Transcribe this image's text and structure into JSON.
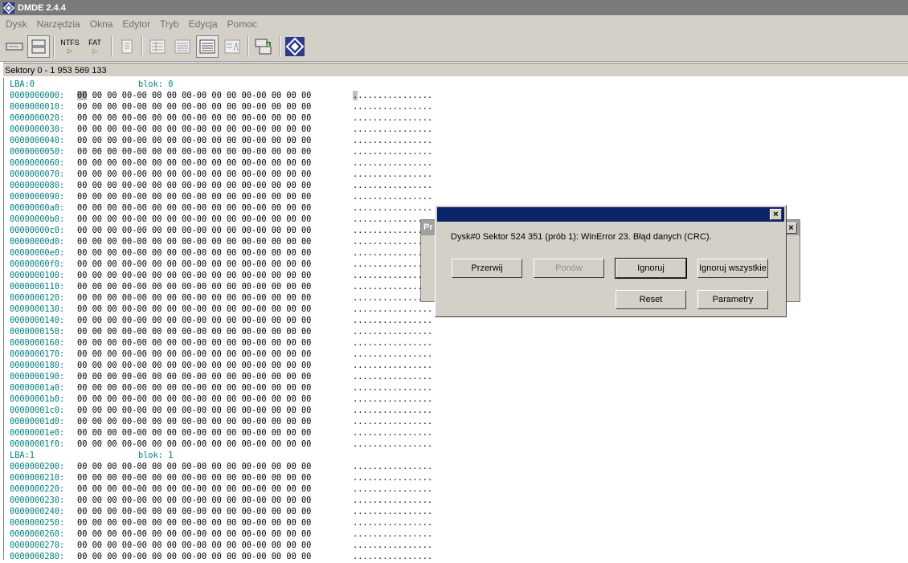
{
  "window": {
    "title": "DMDE 2.4.4"
  },
  "menu": [
    "Dysk",
    "Narzędzia",
    "Okna",
    "Edytor",
    "Tryb",
    "Edycja",
    "Pomoc"
  ],
  "toolbar": {
    "ntfs_label": "NTFS",
    "fat_label": "FAT"
  },
  "status": {
    "sectors": "Sektory 0 - 1 953 569 133"
  },
  "hex": {
    "sections": [
      {
        "lba": "LBA:0",
        "blok": "blok: 0",
        "addresses": [
          "0000000000:",
          "0000000010:",
          "0000000020:",
          "0000000030:",
          "0000000040:",
          "0000000050:",
          "0000000060:",
          "0000000070:",
          "0000000080:",
          "0000000090:",
          "00000000a0:",
          "00000000b0:",
          "00000000c0:",
          "00000000d0:",
          "00000000e0:",
          "00000000f0:",
          "0000000100:",
          "0000000110:",
          "0000000120:",
          "0000000130:",
          "0000000140:",
          "0000000150:",
          "0000000160:",
          "0000000170:",
          "0000000180:",
          "0000000190:",
          "00000001a0:",
          "00000001b0:",
          "00000001c0:",
          "00000001d0:",
          "00000001e0:",
          "00000001f0:"
        ]
      },
      {
        "lba": "LBA:1",
        "blok": "blok: 1",
        "addresses": [
          "0000000200:",
          "0000000210:",
          "0000000220:",
          "0000000230:",
          "0000000240:",
          "0000000250:",
          "0000000260:",
          "0000000270:",
          "0000000280:"
        ]
      }
    ],
    "bytes": "00 00 00 00-00 00 00 00-00 00 00 00-00 00 00 00",
    "bytes_rest": " 00 00 00-00 00 00 00-00 00 00 00-00 00 00 00",
    "first_byte": "00",
    "ascii": "................",
    "ascii_rest": "..............."
  },
  "background_window": {
    "title_fragment": "Pr",
    "close": "×"
  },
  "dialog": {
    "close": "×",
    "message": "Dysk#0 Sektor 524 351 (prób 1): WinError 23. Błąd danych (CRC).",
    "buttons": {
      "abort": "Przerwij",
      "retry": "Ponów",
      "ignore": "Ignoruj",
      "ignore_all": "Ignoruj wszystkie",
      "reset": "Reset",
      "params": "Parametry"
    }
  },
  "colors": {
    "title_active": "#0a246a",
    "hex_address": "#008080",
    "chrome": "#d4d0c8"
  }
}
